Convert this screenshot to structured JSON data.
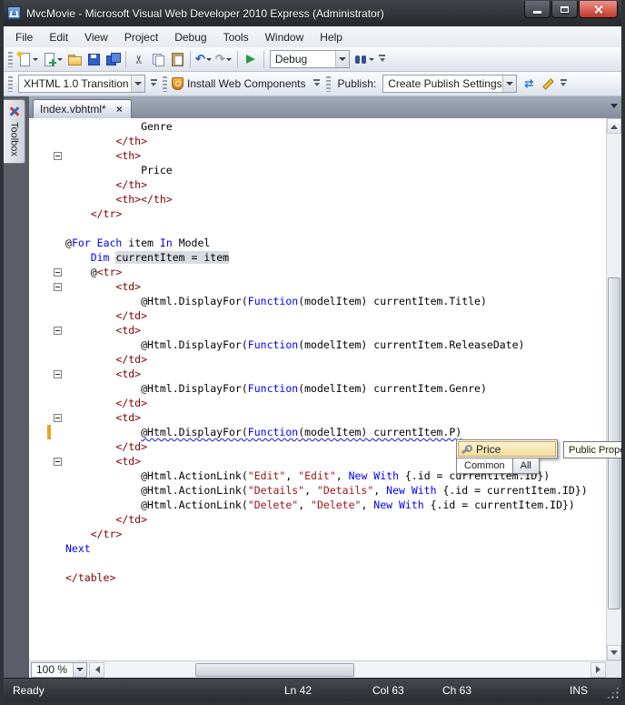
{
  "window": {
    "title": "MvcMovie - Microsoft Visual Web Developer 2010 Express (Administrator)",
    "controls": [
      "minimize",
      "maximize",
      "close"
    ]
  },
  "menu": {
    "items": [
      "File",
      "Edit",
      "View",
      "Project",
      "Debug",
      "Tools",
      "Window",
      "Help"
    ]
  },
  "toolbar_standard": {
    "icons": [
      "new-item",
      "add-item",
      "open-file",
      "save",
      "save-all",
      "cut",
      "copy",
      "paste",
      "undo",
      "redo",
      "start-debugging",
      "find-in-files"
    ],
    "debug_combo_value": "Debug"
  },
  "toolbar_html": {
    "doctype_combo_value": "XHTML 1.0 Transition",
    "install_icon": "security-shield-icon",
    "install_button_label": "Install Web Components",
    "publish_label": "Publish:",
    "publish_combo_value": "Create Publish Settings",
    "icons": [
      "publish-refresh",
      "edit-settings"
    ]
  },
  "tabs": {
    "active_label": "Index.vbhtml*"
  },
  "toolbox": {
    "label": "Toolbox"
  },
  "editor": {
    "zoom_value": "100 %",
    "lines": [
      {
        "seg": [
          [
            "p",
            "            Genre"
          ]
        ]
      },
      {
        "seg": [
          [
            "p",
            "        "
          ],
          [
            "t",
            "</th>"
          ]
        ]
      },
      {
        "f": true,
        "seg": [
          [
            "p",
            "        "
          ],
          [
            "t",
            "<th>"
          ]
        ]
      },
      {
        "seg": [
          [
            "p",
            "            Price"
          ]
        ]
      },
      {
        "seg": [
          [
            "p",
            "        "
          ],
          [
            "t",
            "</th>"
          ]
        ]
      },
      {
        "seg": [
          [
            "p",
            "        "
          ],
          [
            "t",
            "<th></th>"
          ]
        ]
      },
      {
        "seg": [
          [
            "p",
            "    "
          ],
          [
            "t",
            "</tr>"
          ]
        ]
      },
      {
        "seg": []
      },
      {
        "seg": [
          [
            "p",
            "@"
          ],
          [
            "k",
            "For"
          ],
          [
            "p",
            " "
          ],
          [
            "k",
            "Each"
          ],
          [
            "p",
            " item "
          ],
          [
            "k",
            "In"
          ],
          [
            "p",
            " Model"
          ]
        ]
      },
      {
        "seg": [
          [
            "p",
            "    "
          ],
          [
            "k",
            "Dim"
          ],
          [
            "p",
            " "
          ],
          [
            "hl",
            "currentItem = item"
          ]
        ]
      },
      {
        "f": true,
        "seg": [
          [
            "p",
            "    @"
          ],
          [
            "t",
            "<tr>"
          ]
        ]
      },
      {
        "f": true,
        "seg": [
          [
            "p",
            "        "
          ],
          [
            "t",
            "<td>"
          ]
        ]
      },
      {
        "seg": [
          [
            "p",
            "            @Html.DisplayFor("
          ],
          [
            "k",
            "Function"
          ],
          [
            "p",
            "(modelItem) currentItem.Title)"
          ]
        ]
      },
      {
        "seg": [
          [
            "p",
            "        "
          ],
          [
            "t",
            "</td>"
          ]
        ]
      },
      {
        "f": true,
        "seg": [
          [
            "p",
            "        "
          ],
          [
            "t",
            "<td>"
          ]
        ]
      },
      {
        "seg": [
          [
            "p",
            "            @Html.DisplayFor("
          ],
          [
            "k",
            "Function"
          ],
          [
            "p",
            "(modelItem) currentItem.ReleaseDate)"
          ]
        ]
      },
      {
        "seg": [
          [
            "p",
            "        "
          ],
          [
            "t",
            "</td>"
          ]
        ]
      },
      {
        "f": true,
        "seg": [
          [
            "p",
            "        "
          ],
          [
            "t",
            "<td>"
          ]
        ]
      },
      {
        "seg": [
          [
            "p",
            "            @Html.DisplayFor("
          ],
          [
            "k",
            "Function"
          ],
          [
            "p",
            "(modelItem) currentItem.Genre)"
          ]
        ]
      },
      {
        "seg": [
          [
            "p",
            "        "
          ],
          [
            "t",
            "</td>"
          ]
        ]
      },
      {
        "f": true,
        "seg": [
          [
            "p",
            "        "
          ],
          [
            "t",
            "<td>"
          ]
        ]
      },
      {
        "cb": true,
        "seg": [
          [
            "p",
            "            "
          ],
          [
            "p e",
            "@Html.DisplayFor("
          ],
          [
            "k e",
            "Function"
          ],
          [
            "p e",
            "(modelItem) currentItem.P)"
          ]
        ]
      },
      {
        "seg": [
          [
            "p",
            "        "
          ],
          [
            "t",
            "</td>"
          ]
        ]
      },
      {
        "f": true,
        "seg": [
          [
            "p",
            "        "
          ],
          [
            "t",
            "<td>"
          ]
        ]
      },
      {
        "seg": [
          [
            "p",
            "            @Html.ActionLink("
          ],
          [
            "s",
            "\"Edit\""
          ],
          [
            "p",
            ", "
          ],
          [
            "s",
            "\"Edit\""
          ],
          [
            "p",
            ", "
          ],
          [
            "k",
            "New With"
          ],
          [
            "p",
            " {.id = currentItem.ID})"
          ]
        ]
      },
      {
        "seg": [
          [
            "p",
            "            @Html.ActionLink("
          ],
          [
            "s",
            "\"Details\""
          ],
          [
            "p",
            ", "
          ],
          [
            "s",
            "\"Details\""
          ],
          [
            "p",
            ", "
          ],
          [
            "k",
            "New With"
          ],
          [
            "p",
            " {.id = currentItem.ID})"
          ]
        ]
      },
      {
        "seg": [
          [
            "p",
            "            @Html.ActionLink("
          ],
          [
            "s",
            "\"Delete\""
          ],
          [
            "p",
            ", "
          ],
          [
            "s",
            "\"Delete\""
          ],
          [
            "p",
            ", "
          ],
          [
            "k",
            "New With"
          ],
          [
            "p",
            " {.id = currentItem.ID})"
          ]
        ]
      },
      {
        "seg": [
          [
            "p",
            "        "
          ],
          [
            "t",
            "</td>"
          ]
        ]
      },
      {
        "seg": [
          [
            "p",
            "    "
          ],
          [
            "t",
            "</tr>"
          ]
        ]
      },
      {
        "seg": [
          [
            "k",
            "Next"
          ]
        ]
      },
      {
        "seg": []
      },
      {
        "seg": [
          [
            "t",
            "</table>"
          ]
        ]
      }
    ]
  },
  "intellisense": {
    "selected_item": "Price",
    "selected_item_icon": "property-icon",
    "tabs": [
      "Common",
      "All"
    ],
    "tooltip": "Public Prope"
  },
  "statusbar": {
    "state": "Ready",
    "line": "Ln 42",
    "column": "Col 63",
    "char": "Ch 63",
    "mode": "INS"
  },
  "colors": {
    "keyword": "#0000ff",
    "html_tag": "#800000",
    "string": "#a31515",
    "change_bar": "#efa023",
    "squiggle": "#3a3ad4"
  }
}
